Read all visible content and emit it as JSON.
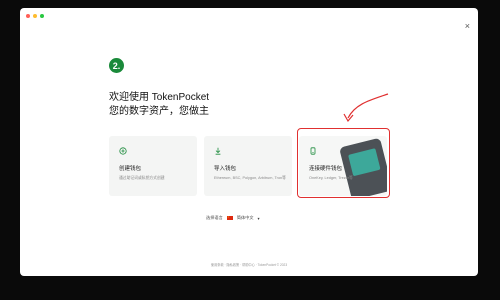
{
  "window": {
    "traffic_colors": [
      "#ff5f57",
      "#febc2e",
      "#28c840"
    ],
    "close_glyph": "×"
  },
  "welcome": {
    "logo_char": "2.",
    "title_line1": "欢迎使用 TokenPocket",
    "title_line2": "您的数字资产，您做主"
  },
  "cards": [
    {
      "icon": "plus-circle-icon",
      "title": "创建钱包",
      "subtitle": "通过助记词或私钥方式创建"
    },
    {
      "icon": "import-arrow-icon",
      "title": "导入钱包",
      "subtitle": "Ethereum, BSC, Polygon, Arbitrum, Tron等"
    },
    {
      "icon": "hardware-device-icon",
      "title": "连接硬件钱包",
      "subtitle": "OneKey, Ledger, Trezor等"
    }
  ],
  "selector": {
    "label": "选择语言",
    "value": "简体中文",
    "flag_icon": "china-flag-icon",
    "caret": "▾"
  },
  "footer": {
    "text": "使用条款 · 隐私政策 · 帮助中心 · TokenPocket © 2023"
  },
  "accent": {
    "brand_green": "#1a8a3a",
    "annotation_red": "#e03030"
  }
}
